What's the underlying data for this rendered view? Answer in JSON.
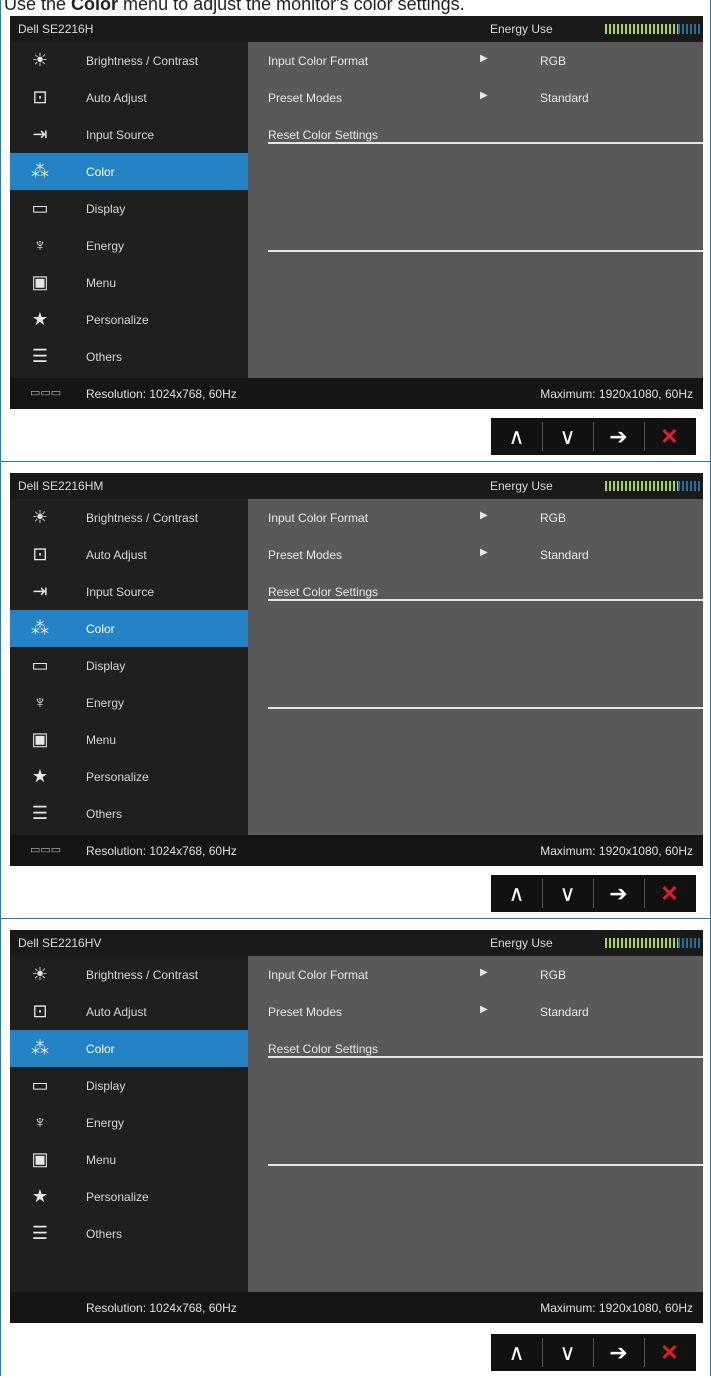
{
  "intro": {
    "prefix": "Use the ",
    "bold": "Color",
    "suffix": " menu to adjust the monitor's color settings."
  },
  "panels": [
    {
      "model": "Dell SE2216H",
      "energy_label": "Energy Use",
      "menu": [
        {
          "icon": "sun-icon",
          "glyph": "☀",
          "label": "Brightness / Contrast"
        },
        {
          "icon": "auto-adjust-icon",
          "glyph": "⊡",
          "label": "Auto Adjust"
        },
        {
          "icon": "input-source-icon",
          "glyph": "⇥",
          "label": "Input Source"
        },
        {
          "icon": "color-icon",
          "glyph": "⁂",
          "label": "Color",
          "active": true
        },
        {
          "icon": "display-icon",
          "glyph": "▭",
          "label": "Display"
        },
        {
          "icon": "energy-icon",
          "glyph": "♆",
          "label": "Energy"
        },
        {
          "icon": "menu-icon",
          "glyph": "▣",
          "label": "Menu"
        },
        {
          "icon": "star-icon",
          "glyph": "★",
          "label": "Personalize"
        },
        {
          "icon": "others-icon",
          "glyph": "☰",
          "label": "Others"
        }
      ],
      "rows": [
        {
          "label": "Input Color Format",
          "arrow": "▶",
          "value": "RGB"
        },
        {
          "label": "Preset Modes",
          "arrow": "▶",
          "value": "Standard"
        },
        {
          "label": "Reset Color Settings",
          "arrow": "",
          "value": ""
        }
      ],
      "resolution": "Resolution: 1024x768, 60Hz",
      "maximum": "Maximum: 1920x1080, 60Hz",
      "dvi": "▭▭▭"
    },
    {
      "model": "Dell SE2216HM",
      "energy_label": "Energy Use",
      "menu": [
        {
          "icon": "sun-icon",
          "glyph": "☀",
          "label": "Brightness / Contrast"
        },
        {
          "icon": "auto-adjust-icon",
          "glyph": "⊡",
          "label": "Auto Adjust"
        },
        {
          "icon": "input-source-icon",
          "glyph": "⇥",
          "label": "Input Source"
        },
        {
          "icon": "color-icon",
          "glyph": "⁂",
          "label": "Color",
          "active": true
        },
        {
          "icon": "display-icon",
          "glyph": "▭",
          "label": "Display"
        },
        {
          "icon": "energy-icon",
          "glyph": "♆",
          "label": "Energy"
        },
        {
          "icon": "menu-icon",
          "glyph": "▣",
          "label": "Menu"
        },
        {
          "icon": "star-icon",
          "glyph": "★",
          "label": "Personalize"
        },
        {
          "icon": "others-icon",
          "glyph": "☰",
          "label": "Others"
        }
      ],
      "rows": [
        {
          "label": "Input Color Format",
          "arrow": "▶",
          "value": "RGB"
        },
        {
          "label": "Preset Modes",
          "arrow": "▶",
          "value": "Standard"
        },
        {
          "label": "Reset Color Settings",
          "arrow": "",
          "value": ""
        }
      ],
      "resolution": "Resolution: 1024x768, 60Hz",
      "maximum": "Maximum: 1920x1080, 60Hz",
      "dvi": "▭▭▭"
    },
    {
      "model": "Dell SE2216HV",
      "energy_label": "Energy Use",
      "menu": [
        {
          "icon": "sun-icon",
          "glyph": "☀",
          "label": "Brightness / Contrast"
        },
        {
          "icon": "auto-adjust-icon",
          "glyph": "⊡",
          "label": "Auto Adjust"
        },
        {
          "icon": "color-icon",
          "glyph": "⁂",
          "label": "Color",
          "active": true
        },
        {
          "icon": "display-icon",
          "glyph": "▭",
          "label": "Display"
        },
        {
          "icon": "energy-icon",
          "glyph": "♆",
          "label": "Energy"
        },
        {
          "icon": "menu-icon",
          "glyph": "▣",
          "label": "Menu"
        },
        {
          "icon": "star-icon",
          "glyph": "★",
          "label": "Personalize"
        },
        {
          "icon": "others-icon",
          "glyph": "☰",
          "label": "Others"
        }
      ],
      "rows": [
        {
          "label": "Input Color Format",
          "arrow": "▶",
          "value": "RGB"
        },
        {
          "label": "Preset Modes",
          "arrow": "▶",
          "value": "Standard"
        },
        {
          "label": "Reset Color Settings",
          "arrow": "",
          "value": ""
        }
      ],
      "resolution": "Resolution: 1024x768, 60Hz",
      "maximum": "Maximum: 1920x1080, 60Hz",
      "dvi": ""
    }
  ],
  "nav_buttons": [
    {
      "name": "up-arrow-button",
      "glyph": "∧"
    },
    {
      "name": "down-arrow-button",
      "glyph": "∨"
    },
    {
      "name": "enter-arrow-button",
      "glyph": "➔"
    },
    {
      "name": "exit-button",
      "glyph": "✕"
    }
  ],
  "colors": {
    "accent": "#2383c4",
    "osd_bg": "#595959",
    "sidebar_bg": "#1f1f1f",
    "exit": "#e02020"
  }
}
